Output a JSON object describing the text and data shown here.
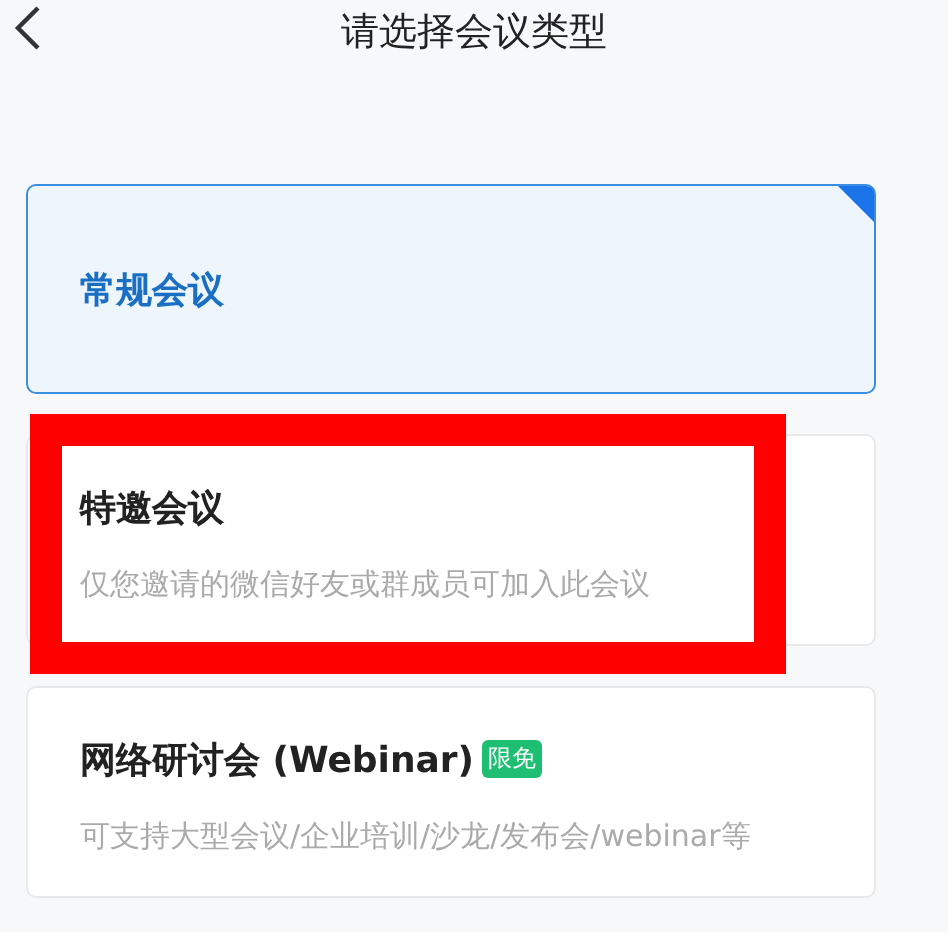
{
  "header": {
    "title": "请选择会议类型"
  },
  "meeting_types": [
    {
      "title": "常规会议",
      "selected": true
    },
    {
      "title": "特邀会议",
      "description": "仅您邀请的微信好友或群成员可加入此会议",
      "selected": false,
      "highlighted": true
    },
    {
      "title": "网络研讨会 (Webinar)",
      "badge": "限免",
      "description": "可支持大型会议/企业培训/沙龙/发布会/webinar等",
      "selected": false
    }
  ]
}
